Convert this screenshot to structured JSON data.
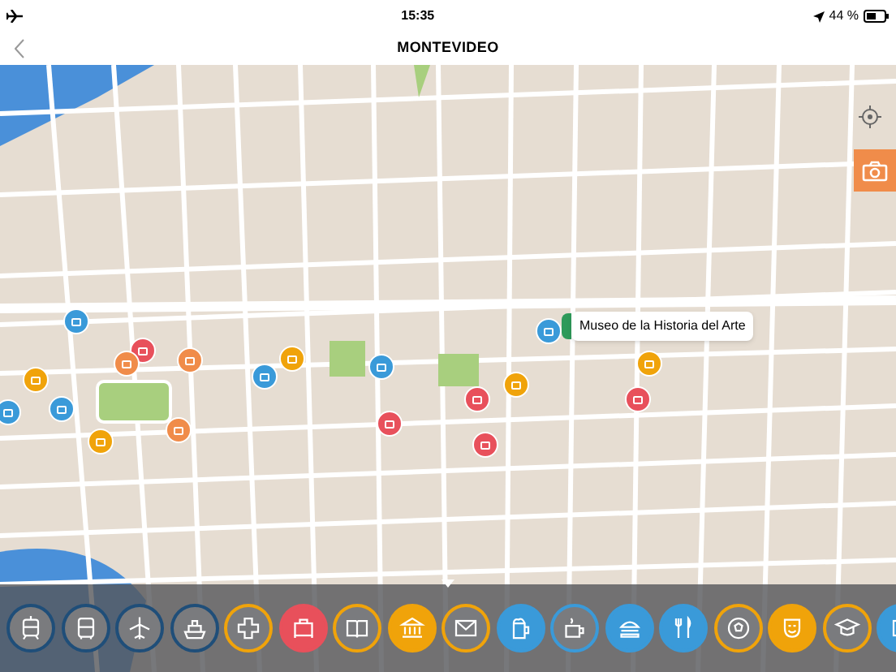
{
  "status_bar": {
    "time": "15:35",
    "battery": "44 %"
  },
  "nav_bar": {
    "title": "MONTEVIDEO"
  },
  "map": {
    "callout": "Museo de la Historia del Arte",
    "pins": [
      {
        "color": "#3a9ad9"
      },
      {
        "color": "#e8505b"
      },
      {
        "color": "#f08c4a"
      },
      {
        "color": "#f08c4a"
      },
      {
        "color": "#3a9ad9"
      },
      {
        "color": "#f0a30a"
      },
      {
        "color": "#3a9ad9"
      },
      {
        "color": "#f0a30a"
      },
      {
        "color": "#e8505b"
      },
      {
        "color": "#e8505b"
      },
      {
        "color": "#e8505b"
      },
      {
        "color": "#f0a30a"
      },
      {
        "color": "#f0a30a"
      },
      {
        "color": "#e8505b"
      },
      {
        "color": "#3a9ad9"
      },
      {
        "color": "#f08c4a"
      },
      {
        "color": "#f0a30a"
      },
      {
        "color": "#3a9ad9"
      },
      {
        "color": "#3a9ad9"
      }
    ]
  },
  "categories": [
    {
      "color": "#1f4e79",
      "selected": false
    },
    {
      "color": "#1f4e79",
      "selected": false
    },
    {
      "color": "#1f4e79",
      "selected": false
    },
    {
      "color": "#1f4e79",
      "selected": false
    },
    {
      "color": "#f0a30a",
      "selected": false
    },
    {
      "color": "#e8505b",
      "selected": true
    },
    {
      "color": "#f0a30a",
      "selected": false
    },
    {
      "color": "#f0a30a",
      "selected": true
    },
    {
      "color": "#f0a30a",
      "selected": false
    },
    {
      "color": "#3a9ad9",
      "selected": true
    },
    {
      "color": "#3a9ad9",
      "selected": false
    },
    {
      "color": "#3a9ad9",
      "selected": true
    },
    {
      "color": "#3a9ad9",
      "selected": true
    },
    {
      "color": "#f0a30a",
      "selected": false
    },
    {
      "color": "#f0a30a",
      "selected": true
    },
    {
      "color": "#f0a30a",
      "selected": false
    },
    {
      "color": "#3a9ad9",
      "selected": true
    }
  ]
}
